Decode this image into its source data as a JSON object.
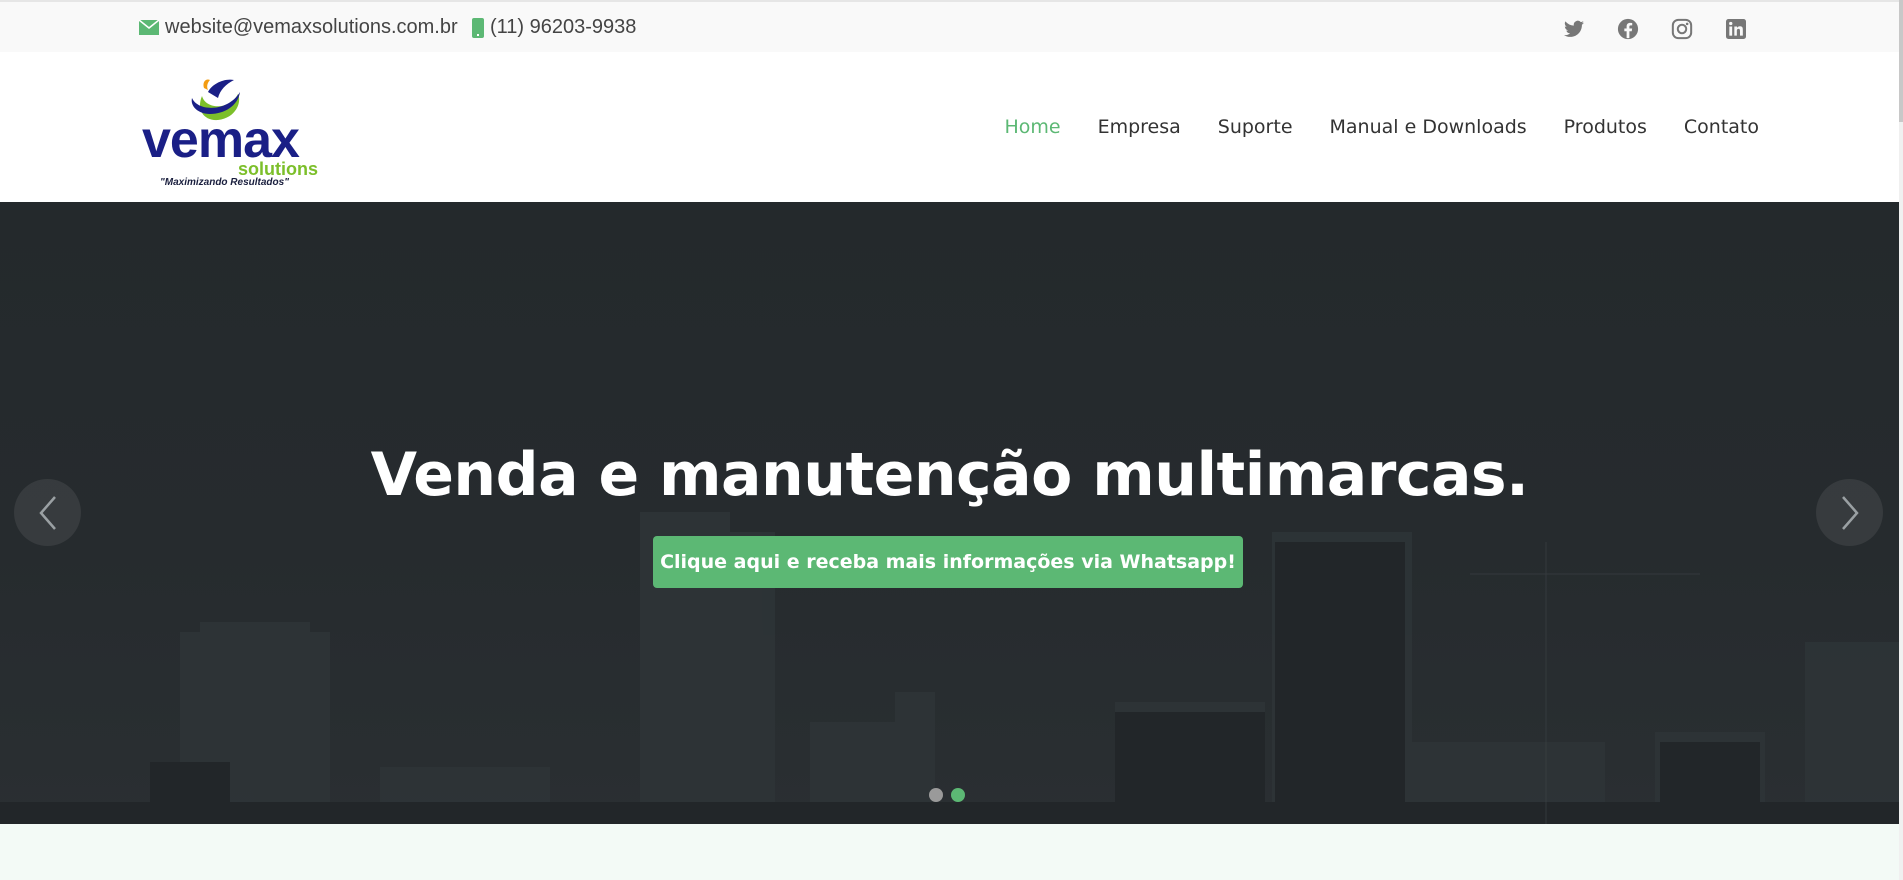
{
  "topbar": {
    "email": "website@vemaxsolutions.com.br",
    "phone": "(11) 96203-9938",
    "social_icons": [
      "twitter-icon",
      "facebook-icon",
      "instagram-icon",
      "linkedin-icon"
    ]
  },
  "logo": {
    "main": "vemax",
    "sub": "solutions",
    "tagline": "\"Maximizando Resultados\""
  },
  "nav": {
    "items": [
      "Home",
      "Empresa",
      "Suporte",
      "Manual e Downloads",
      "Produtos",
      "Contato"
    ],
    "active": "Home"
  },
  "hero": {
    "title": "Venda e manutenção multimarcas.",
    "cta_label": "Clique aqui e receba mais informações via Whatsapp!",
    "slides_count": 2,
    "active_slide": 2
  },
  "colors": {
    "accent": "#5cb874",
    "logo_blue": "#1a1f86",
    "logo_green": "#7cbf2a",
    "hero_bg": "#262b2e"
  }
}
